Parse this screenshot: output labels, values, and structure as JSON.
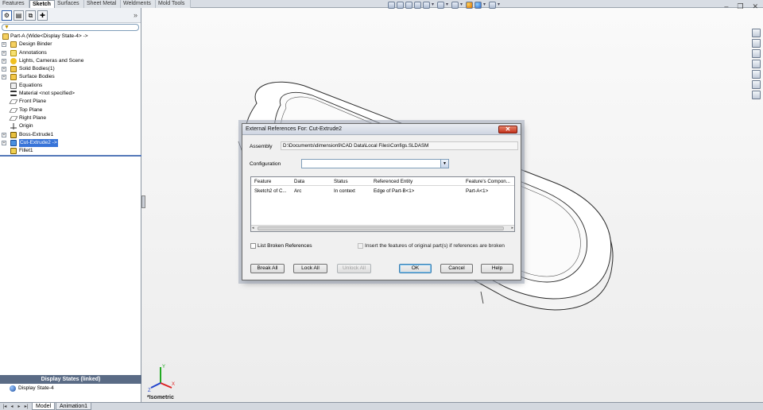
{
  "command_tabs": [
    "Features",
    "Sketch",
    "Surfaces",
    "Sheet Metal",
    "Weldments",
    "Mold Tools"
  ],
  "active_command_tab": "Sketch",
  "tree": {
    "root": "Part-A  (Wide<Display State-4> ->",
    "items": [
      {
        "label": "Design Binder",
        "icon": "design-binder-icon",
        "expandable": true
      },
      {
        "label": "Annotations",
        "icon": "annotations-icon",
        "expandable": true
      },
      {
        "label": "Lights, Cameras and Scene",
        "icon": "lights-icon",
        "expandable": true
      },
      {
        "label": "Solid Bodies(1)",
        "icon": "solid-bodies-icon",
        "expandable": true
      },
      {
        "label": "Surface Bodies",
        "icon": "surface-bodies-icon",
        "expandable": true
      },
      {
        "label": "Equations",
        "icon": "equations-icon",
        "expandable": false
      },
      {
        "label": "Material <not specified>",
        "icon": "material-icon",
        "expandable": false
      },
      {
        "label": "Front Plane",
        "icon": "plane-icon",
        "expandable": false
      },
      {
        "label": "Top Plane",
        "icon": "plane-icon",
        "expandable": false
      },
      {
        "label": "Right Plane",
        "icon": "plane-icon",
        "expandable": false
      },
      {
        "label": "Origin",
        "icon": "origin-icon",
        "expandable": false
      },
      {
        "label": "Boss-Extrude1",
        "icon": "boss-extrude-icon",
        "expandable": true
      },
      {
        "label": "Cut-Extrude2 ->",
        "icon": "cut-extrude-icon",
        "expandable": true,
        "selected": true
      },
      {
        "label": "Fillet1",
        "icon": "fillet-icon",
        "expandable": false
      }
    ]
  },
  "display_states": {
    "header": "Display States (linked)",
    "item": "Display State-4"
  },
  "model_tabs": [
    "Model",
    "Animation1"
  ],
  "view_label": "*Isometric",
  "dialog": {
    "title": "External References For: Cut-Extrude2",
    "close_label": "✕",
    "assembly_label": "Assembly",
    "assembly_path": "D:\\Documents\\dimension9\\CAD Data\\Local Files\\Configs.SLDASM",
    "configuration_label": "Configuration",
    "configuration_value": "",
    "columns": [
      "Feature",
      "Data",
      "Status",
      "Referenced Entity",
      "Feature's Compon..."
    ],
    "rows": [
      [
        "Sketch2  of  C...",
        "Arc",
        "In context",
        "Edge of Part-B<1>",
        "Part-A<1>"
      ]
    ],
    "list_broken_label": "List Broken References",
    "insert_features_label": "Insert the features of original part(s) if references are broken",
    "buttons": {
      "break_all": "Break All",
      "lock_all": "Lock All",
      "unlock_all": "Unlock All",
      "ok": "OK",
      "cancel": "Cancel",
      "help": "Help"
    }
  }
}
